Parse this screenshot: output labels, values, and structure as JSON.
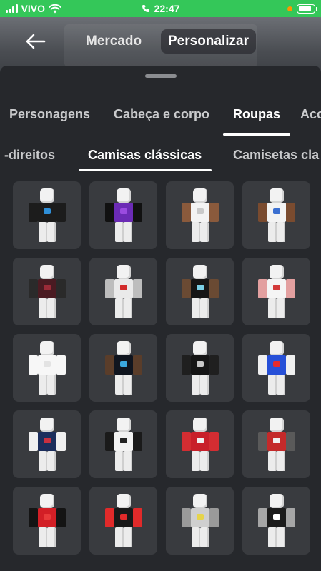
{
  "status_bar": {
    "carrier": "VIVO",
    "time": "22:47",
    "icons": [
      "signal-icon",
      "wifi-icon",
      "phone-icon",
      "battery-icon"
    ]
  },
  "header": {
    "back_icon": "arrow-left-icon",
    "tabs": [
      {
        "label": "Mercado"
      },
      {
        "label": "Personalizar"
      }
    ]
  },
  "categories": [
    {
      "label": "Personagens"
    },
    {
      "label": "Cabeça e corpo"
    },
    {
      "label": "Roupas"
    },
    {
      "label": "Acc"
    }
  ],
  "subcategories": [
    {
      "label": "direitos"
    },
    {
      "label": "Camisas clássicas"
    },
    {
      "label": "Camisetas cla"
    }
  ],
  "items": [
    {
      "name": "black-shirt",
      "torso": "#1c1c1c",
      "arms": "#1c1c1c",
      "accent": "#2f8fd8"
    },
    {
      "name": "purple-striped-shirt",
      "torso": "#6b2bb5",
      "arms": "#111111",
      "accent": "#9a4be0"
    },
    {
      "name": "white-brown-shirt",
      "torso": "#f3f3f3",
      "arms": "#8a5a3c",
      "accent": "#c9c9c9"
    },
    {
      "name": "white-brown-logo-shirt",
      "torso": "#f3f3f3",
      "arms": "#7a4b2f",
      "accent": "#3b6fd1"
    },
    {
      "name": "dark-red-jacket",
      "torso": "#4a1b22",
      "arms": "#2a2a2a",
      "accent": "#9b2b38"
    },
    {
      "name": "white-bulls-jersey",
      "torso": "#eaeaea",
      "arms": "#bdbdbd",
      "accent": "#d22b2b"
    },
    {
      "name": "black-brown-shirt",
      "torso": "#161616",
      "arms": "#6a4a33",
      "accent": "#7bd0e6"
    },
    {
      "name": "white-red-pattern-shirt",
      "torso": "#f5f5f5",
      "arms": "#e3a0a0",
      "accent": "#d33a3a"
    },
    {
      "name": "plain-white-shirt",
      "torso": "#f7f7f7",
      "arms": "#f7f7f7",
      "accent": "#e3e3e3"
    },
    {
      "name": "black-galaxy-shirt",
      "torso": "#10151f",
      "arms": "#5a3d2a",
      "accent": "#3aa8e0"
    },
    {
      "name": "black-graphic-shirt",
      "torso": "#151515",
      "arms": "#1f1f1f",
      "accent": "#c8c8c8"
    },
    {
      "name": "superman-shirt",
      "torso": "#2750d8",
      "arms": "#f0f0f0",
      "accent": "#e62b2b"
    },
    {
      "name": "navy-psg-shirt",
      "torso": "#1c2e5c",
      "arms": "#f0f0f0",
      "accent": "#c83040"
    },
    {
      "name": "black-white-striped-shirt",
      "torso": "#f2f2f2",
      "arms": "#1a1a1a",
      "accent": "#222222"
    },
    {
      "name": "red-jersey",
      "torso": "#c8202a",
      "arms": "#d32d32",
      "accent": "#f0f0f0"
    },
    {
      "name": "red-camo-shirt",
      "torso": "#c42a2a",
      "arms": "#5a5a5a",
      "accent": "#f0f0f0"
    },
    {
      "name": "red-black-stripe-shirt",
      "torso": "#d21f26",
      "arms": "#141414",
      "accent": "#e83a3a"
    },
    {
      "name": "red-black-vest",
      "torso": "#191919",
      "arms": "#e12a2a",
      "accent": "#e12a2a"
    },
    {
      "name": "grey-camo-shirt",
      "torso": "#cfcfcf",
      "arms": "#9a9a9a",
      "accent": "#e6d44a"
    },
    {
      "name": "black-grey-vest",
      "torso": "#1b1b1b",
      "arms": "#a6a6a6",
      "accent": "#ffffff"
    }
  ]
}
